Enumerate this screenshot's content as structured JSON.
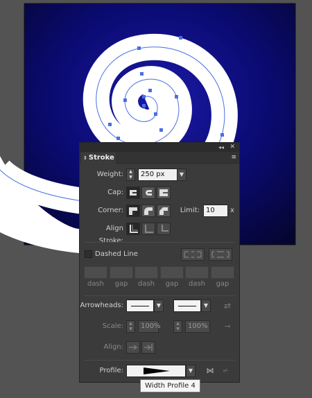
{
  "panel": {
    "tab_label": "Stroke",
    "collapse_label": "◂◂",
    "close_label": "✕",
    "menu_label": "≡"
  },
  "weight": {
    "label": "Weight:",
    "value": "250 px"
  },
  "cap": {
    "label": "Cap:"
  },
  "corner": {
    "label": "Corner:",
    "limit_label": "Limit:",
    "limit_value": "10",
    "limit_unit": "x"
  },
  "align_stroke": {
    "label": "Align Stroke:"
  },
  "dashed": {
    "label": "Dashed Line",
    "checked": false,
    "field_labels": [
      "dash",
      "gap",
      "dash",
      "gap",
      "dash",
      "gap"
    ]
  },
  "arrowheads": {
    "label": "Arrowheads:"
  },
  "scale": {
    "label": "Scale:",
    "start_value": "100%",
    "end_value": "100%"
  },
  "align": {
    "label": "Align:"
  },
  "profile": {
    "label": "Profile:"
  },
  "tooltip": {
    "text": "Width Profile 4"
  },
  "colors": {
    "artboard_bg": "#0b0b56",
    "canvas_bg": "#535353",
    "spiral": "#ffffff",
    "selection": "#4a6fe0"
  }
}
